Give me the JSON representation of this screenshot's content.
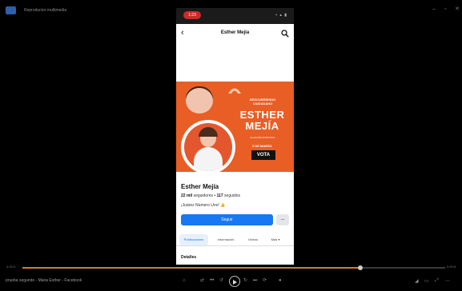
{
  "window": {
    "title": "Reproductor multimedia",
    "minimize": "–",
    "maximize": "▫",
    "close": "✕"
  },
  "phone": {
    "status": {
      "rec": "1:23",
      "icons": "▪ ▴ ▮"
    },
    "header": {
      "back_icon": "back-arrow-icon",
      "title": "Esther Mejía",
      "search_icon": "search-icon"
    },
    "cover": {
      "top_text": "DESCUBRIENDO CIUDADANO",
      "name": "ESTHER MEJÍA",
      "tagline": "ALCALDÍA MUNICIPAL",
      "date": "3 DE MARZO",
      "cta": "VOTA"
    },
    "profile": {
      "name": "Esther Mejía",
      "followers_count": "22 mil",
      "followers_label": "seguidores",
      "following_count": "117",
      "following_label": "seguidos",
      "bio": "¡Juárez Número Uno! 👍",
      "follow_button": "Seguir",
      "more_button": "..."
    },
    "tabs": [
      "Publicaciones",
      "Información",
      "Videos",
      "Más ▾"
    ],
    "details_title": "Detalles"
  },
  "player": {
    "elapsed": "0:00:3",
    "remaining": "0:00:5",
    "progress": 0.8,
    "video_title": "prueba segundo - Maria Esther - Facebook"
  }
}
